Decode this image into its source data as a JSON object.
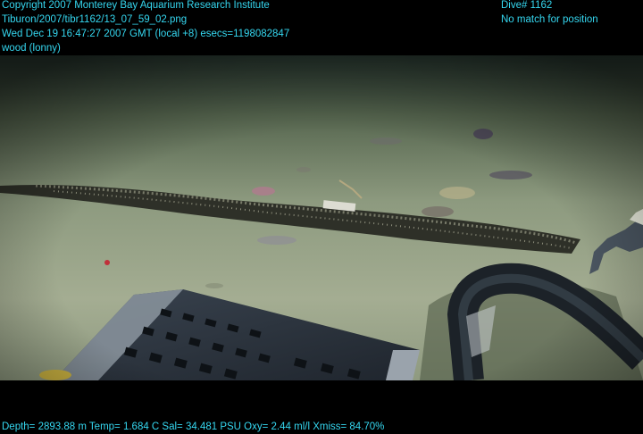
{
  "overlay": {
    "copyright": "Copyright 2007 Monterey Bay Aquarium Research Institute",
    "file_path": "Tiburon/2007/tibr1162/13_07_59_02.png",
    "timestamp": "Wed Dec 19 16:47:27 2007 GMT (local +8)  esecs=1198082847",
    "annotation": "wood (lonny)",
    "dive": "Dive# 1162",
    "position_status": "No match for position",
    "sensors": "Depth= 2893.88 m  Temp= 1.684 C  Sal= 34.481 PSU  Oxy= 2.44 ml/l  Xmiss= 84.70%"
  },
  "colors": {
    "overlay_text": "#35d7f0",
    "sediment": "#9aa58a",
    "water_far": "#25342c"
  }
}
